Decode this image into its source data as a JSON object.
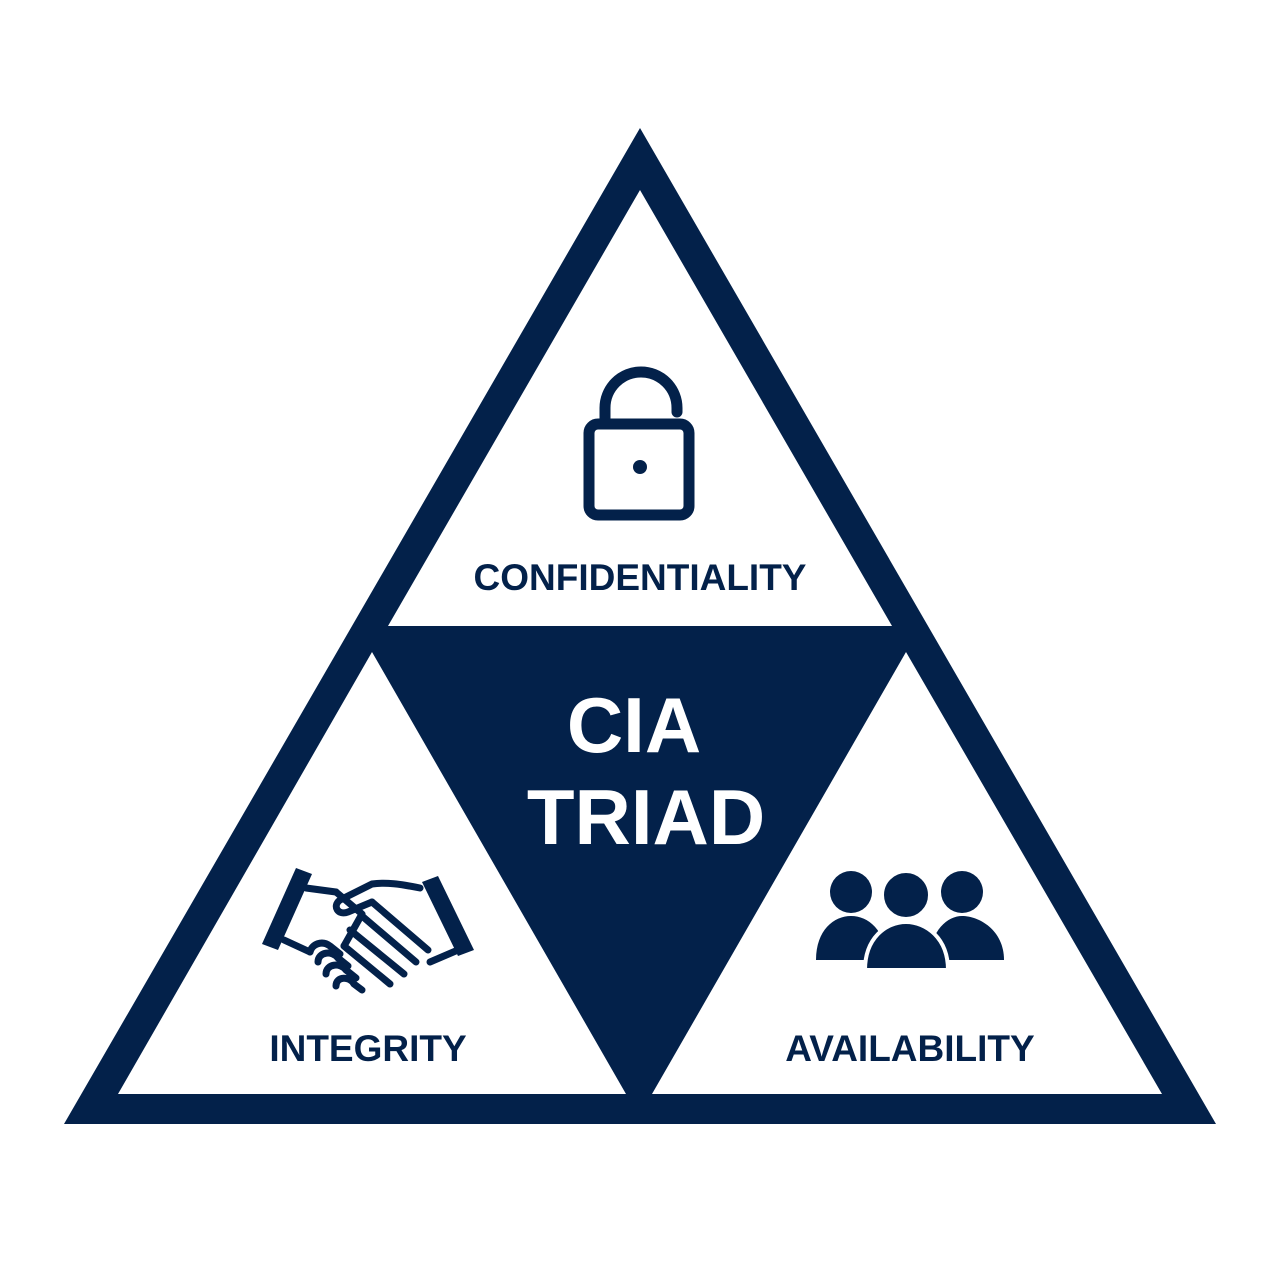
{
  "colors": {
    "navy": "#03214a",
    "background": "#ffffff"
  },
  "center": {
    "line1": "CIA",
    "line2": "TRIAD"
  },
  "sections": {
    "confidentiality": {
      "label": "CONFIDENTIALITY",
      "icon": "open-padlock-icon"
    },
    "integrity": {
      "label": "INTEGRITY",
      "icon": "handshake-icon"
    },
    "availability": {
      "label": "AVAILABILITY",
      "icon": "people-group-icon"
    }
  }
}
